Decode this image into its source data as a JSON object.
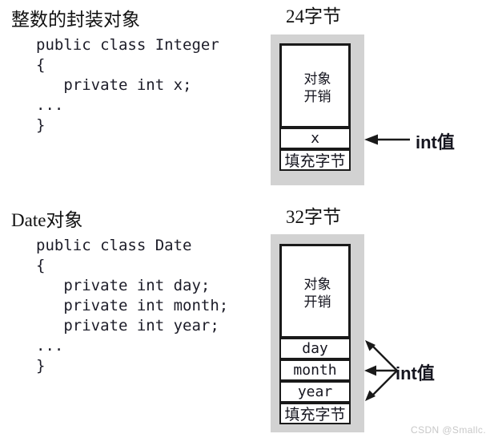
{
  "figure": {
    "watermark": "CSDN @Smallc."
  },
  "sections": [
    {
      "title": "整数的封装对象",
      "code": "public class Integer\n{\n   private int x;\n...\n}"
    },
    {
      "title": "Date对象",
      "code": "public class Date\n{\n   private int day;\n   private int month;\n   private int year;\n...\n}"
    }
  ],
  "diagrams": [
    {
      "title": "24字节",
      "overhead": "对象\n开销",
      "fields": [
        "x"
      ],
      "padding": "填充字节",
      "annotation_prefix": "int",
      "annotation_suffix": "值"
    },
    {
      "title": "32字节",
      "overhead": "对象\n开销",
      "fields": [
        "day",
        "month",
        "year"
      ],
      "padding": "填充字节",
      "annotation_prefix": "int",
      "annotation_suffix": "值"
    }
  ]
}
